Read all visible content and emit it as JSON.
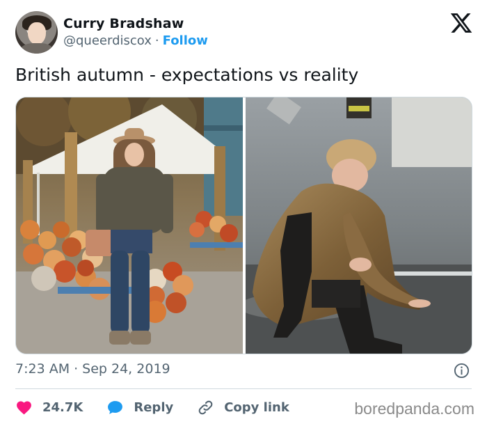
{
  "author": {
    "name": "Curry Bradshaw",
    "handle": "@queerdiscox",
    "separator": "·",
    "follow_label": "Follow",
    "avatar_icon": "avatar-photo"
  },
  "brand_icon": "x-logo-icon",
  "tweet": {
    "text": "British autumn - expectations vs reality"
  },
  "media": {
    "left_image": "woman-with-hat-posing-at-pumpkin-patch",
    "right_image": "woman-in-leather-coat-sitting-on-wet-street"
  },
  "meta": {
    "time": "7:23 AM",
    "separator": "·",
    "date": "Sep 24, 2019",
    "info_icon": "info-icon"
  },
  "actions": {
    "like_count": "24.7K",
    "reply_label": "Reply",
    "copy_label": "Copy link",
    "like_color": "#f91880",
    "reply_color": "#1d9bf0"
  },
  "watermark": "boredpanda.com"
}
